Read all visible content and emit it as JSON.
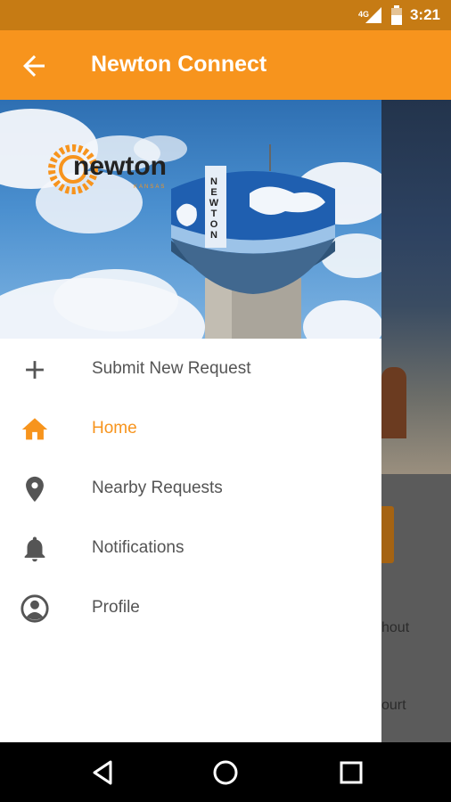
{
  "status_bar": {
    "time": "3:21",
    "network": "4G"
  },
  "app_bar": {
    "title": "Newton Connect"
  },
  "drawer": {
    "logo_text": "newton",
    "logo_sub": "KANSAS",
    "tower_text": "NEWTON",
    "items": [
      {
        "label": "Submit New Request",
        "icon": "plus-icon"
      },
      {
        "label": "Home",
        "icon": "home-icon",
        "active": true
      },
      {
        "label": "Nearby Requests",
        "icon": "location-pin-icon"
      },
      {
        "label": "Notifications",
        "icon": "bell-icon"
      },
      {
        "label": "Profile",
        "icon": "account-circle-icon"
      }
    ]
  },
  "main": {
    "text_1": "hout",
    "text_2": "ourt"
  },
  "colors": {
    "accent": "#f7941d",
    "status_bar": "#c67b14",
    "icon_gray": "#555555"
  }
}
